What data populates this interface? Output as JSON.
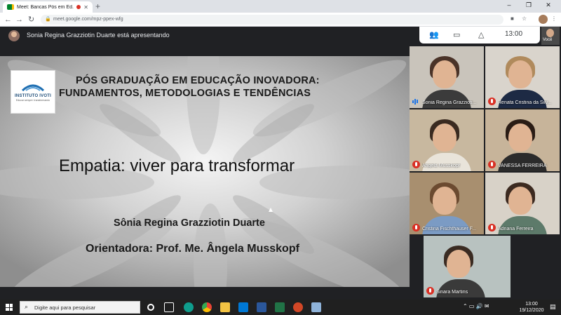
{
  "browser": {
    "tab_title": "Meet: Bancas Pós em Ed. Ino",
    "url": "meet.google.com/mpz-ppex-wfg",
    "new_tab_label": "+",
    "minimize": "–",
    "maximize": "❐",
    "close": "✕"
  },
  "meet": {
    "presenting_text": "Sonia Regina Grazziotin Duarte está apresentando",
    "clock": "13:00",
    "self_label": "Você"
  },
  "slide": {
    "heading_line1": "PÓS GRADUAÇÃO EM EDUCAÇÃO INOVADORA:",
    "heading_line2": "FUNDAMENTOS, METODOLOGIAS E TENDÊNCIAS",
    "title": "Empatia: viver para transformar",
    "author": "Sônia Regina Grazziotin Duarte",
    "advisor": "Orientadora: Prof. Me. Ângela Musskopf",
    "logo_name": "INSTITUTO IVOTI",
    "logo_tagline": "Educar sempre: transformando"
  },
  "participants": [
    {
      "name": "Sonia Regina Grazzioti...",
      "state": "speaking",
      "bg": "#c9c4bb",
      "hair": "#4a3328",
      "body": "#3b3b3b"
    },
    {
      "name": "Renata Cristina da Silv...",
      "state": "muted",
      "bg": "#d9d4cc",
      "hair": "#b08a5c",
      "body": "#1d2a44"
    },
    {
      "name": "Ângela Musskopf",
      "state": "muted",
      "bg": "#c8b89f",
      "hair": "#3a2a20",
      "body": "#e9e4da"
    },
    {
      "name": "VANESSA FERREIRA",
      "state": "muted",
      "bg": "#c7b49a",
      "hair": "#2a1c15",
      "body": "#2b2b2b"
    },
    {
      "name": "Cristina Fischthauser F...",
      "state": "muted",
      "bg": "#a88f6f",
      "hair": "#6b4a30",
      "body": "#7b9bc4"
    },
    {
      "name": "Adriana Ferreira",
      "state": "muted",
      "bg": "#d8d2c8",
      "hair": "#3c2a20",
      "body": "#5d7a6a"
    },
    {
      "name": "Sinara Martins",
      "state": "muted",
      "bg": "#b8c2c0",
      "hair": "#3a2b22",
      "body": "#3a3a3a"
    }
  ],
  "taskbar": {
    "search_placeholder": "Digite aqui para pesquisar",
    "time": "13:00",
    "date": "19/12/2020"
  }
}
